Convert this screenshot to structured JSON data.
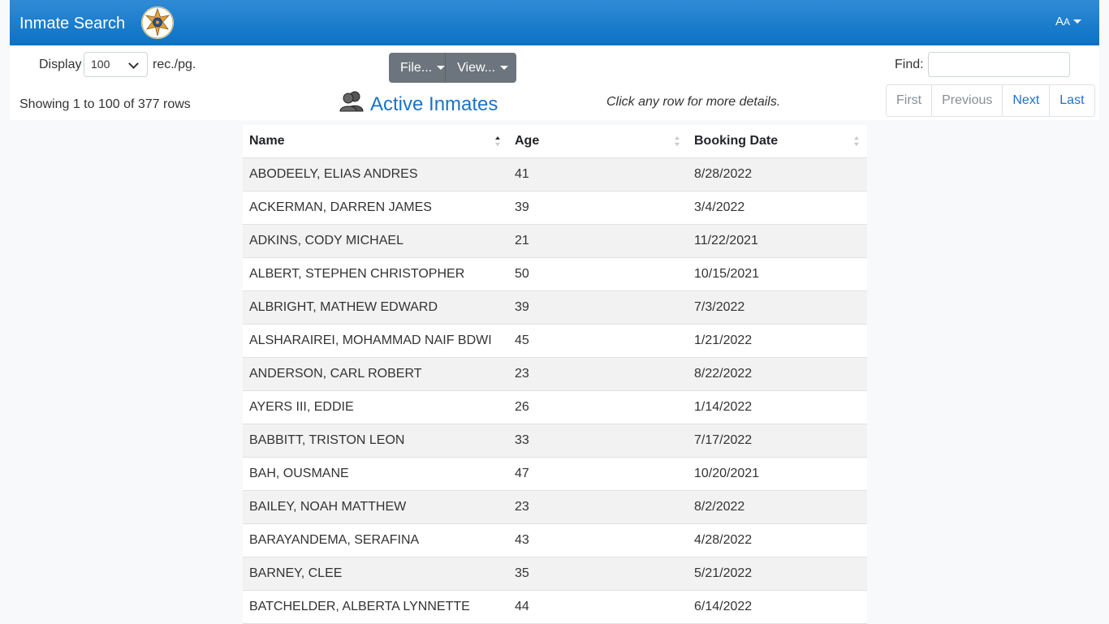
{
  "header": {
    "title": "Inmate Search",
    "font_toggle": "AA"
  },
  "controls": {
    "display_label": "Display",
    "display_value": "100",
    "rec_label": "rec./pg.",
    "file_button": "File...",
    "view_button": "View...",
    "find_label": "Find:",
    "find_value": ""
  },
  "status": {
    "showing": "Showing 1 to 100 of 377 rows",
    "title": "Active Inmates",
    "hint": "Click any row for more details."
  },
  "pager": {
    "first": "First",
    "previous": "Previous",
    "next": "Next",
    "last": "Last"
  },
  "table": {
    "columns": [
      "Name",
      "Age",
      "Booking Date"
    ],
    "rows": [
      [
        "ABODEELY, ELIAS ANDRES",
        "41",
        "8/28/2022"
      ],
      [
        "ACKERMAN, DARREN JAMES",
        "39",
        "3/4/2022"
      ],
      [
        "ADKINS, CODY MICHAEL",
        "21",
        "11/22/2021"
      ],
      [
        "ALBERT, STEPHEN CHRISTOPHER",
        "50",
        "10/15/2021"
      ],
      [
        "ALBRIGHT, MATHEW EDWARD",
        "39",
        "7/3/2022"
      ],
      [
        "ALSHARAIREI, MOHAMMAD NAIF BDWI",
        "45",
        "1/21/2022"
      ],
      [
        "ANDERSON, CARL ROBERT",
        "23",
        "8/22/2022"
      ],
      [
        "AYERS III, EDDIE",
        "26",
        "1/14/2022"
      ],
      [
        "BABBITT, TRISTON LEON",
        "33",
        "7/17/2022"
      ],
      [
        "BAH, OUSMANE",
        "47",
        "10/20/2021"
      ],
      [
        "BAILEY, NOAH MATTHEW",
        "23",
        "8/2/2022"
      ],
      [
        "BARAYANDEMA, SERAFINA",
        "43",
        "4/28/2022"
      ],
      [
        "BARNEY, CLEE",
        "35",
        "5/21/2022"
      ],
      [
        "BATCHELDER, ALBERTA LYNNETTE",
        "44",
        "6/14/2022"
      ]
    ]
  },
  "colors": {
    "navbar": "#0b72c4",
    "accent": "#1a73c7",
    "button": "#6c757d"
  },
  "icons": {
    "badge": "sheriff-star-badge-icon",
    "title": "people-icon"
  }
}
